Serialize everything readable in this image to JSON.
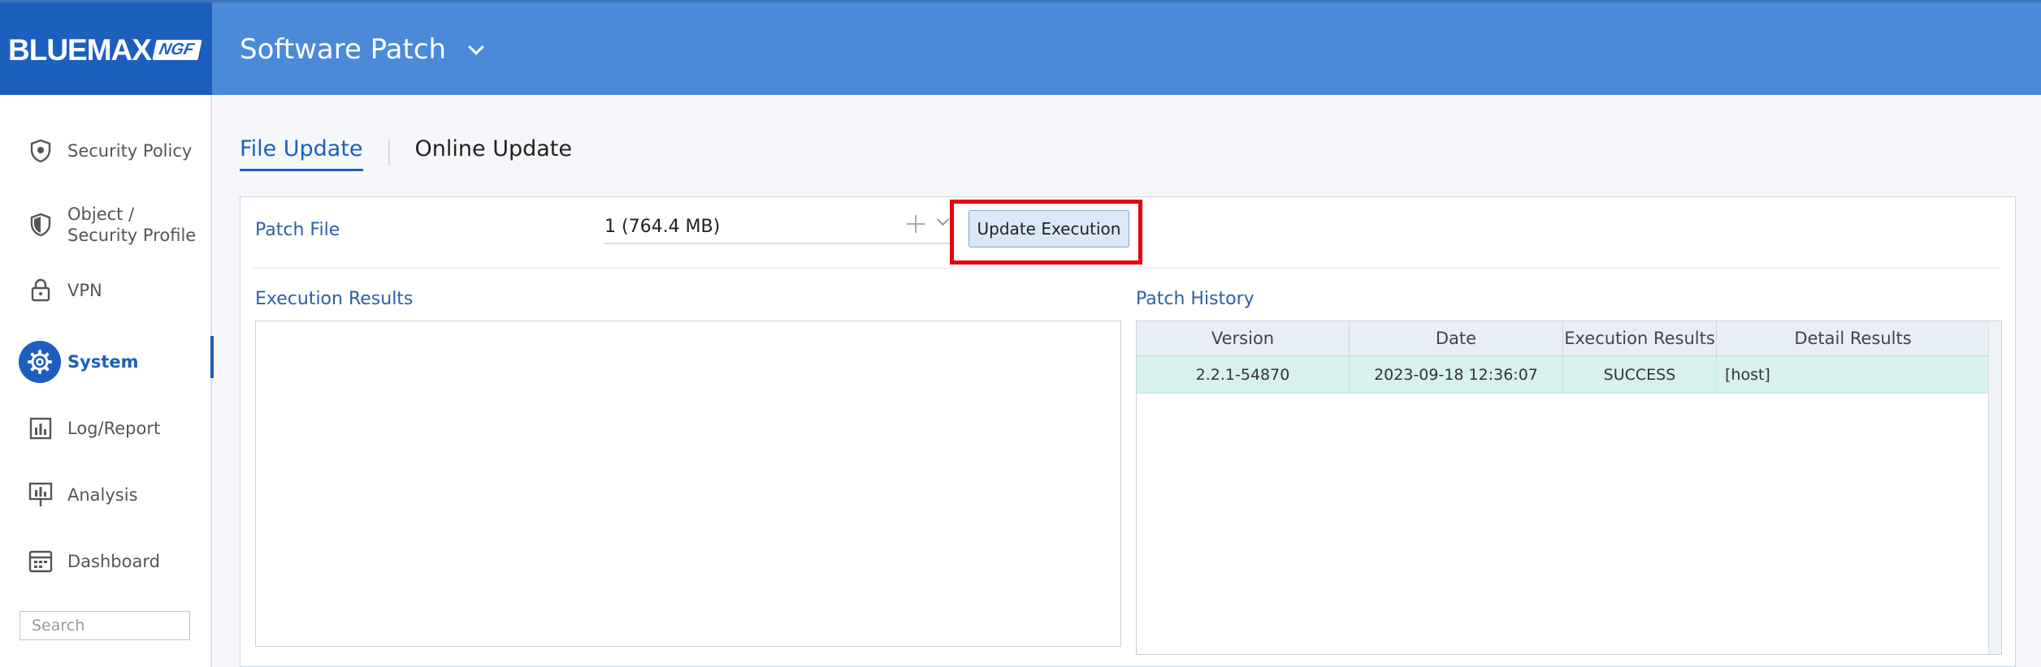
{
  "brand": {
    "name": "BLUEMAX",
    "badge": "NGF",
    "accent": "#1d5fbf",
    "header_color": "#4a8ad9"
  },
  "header": {
    "title": "Software Patch",
    "dropdown_icon": "chevron-down-icon"
  },
  "sidebar": {
    "items": [
      {
        "label": "Security Policy",
        "icon": "shield-icon",
        "active": false
      },
      {
        "label": "Object /",
        "label2": "Security Profile",
        "icon": "shield-filled-icon",
        "active": false
      },
      {
        "label": "VPN",
        "icon": "lock-icon",
        "active": false
      },
      {
        "label": "System",
        "icon": "gear-icon",
        "active": true
      },
      {
        "label": "Log/Report",
        "icon": "bar-chart-icon",
        "active": false
      },
      {
        "label": "Analysis",
        "icon": "monitor-chart-icon",
        "active": false
      },
      {
        "label": "Dashboard",
        "icon": "dashboard-icon",
        "active": false
      }
    ],
    "search_placeholder": "Search"
  },
  "tabs": [
    {
      "label": "File Update",
      "active": true
    },
    {
      "label": "Online Update",
      "active": false
    }
  ],
  "patch": {
    "label": "Patch File",
    "value": "1 (764.4 MB)",
    "button": "Update Execution"
  },
  "execution": {
    "title": "Execution Results"
  },
  "history": {
    "title": "Patch History",
    "columns": [
      "Version",
      "Date",
      "Execution Results",
      "Detail Results"
    ],
    "rows": [
      [
        "2.2.1-54870",
        "2023-09-18 12:36:07",
        "SUCCESS",
        "[host]"
      ]
    ]
  }
}
